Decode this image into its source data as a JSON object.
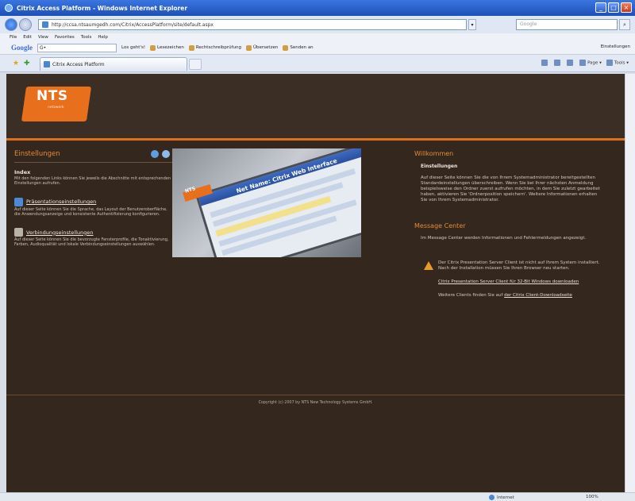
{
  "window": {
    "title": "Citrix Access Platform - Windows Internet Explorer",
    "buttons": [
      "_",
      "□",
      "×"
    ]
  },
  "address": {
    "url": "http://ccsa.ntsaumgedh.com/Citrix/AccessPlatform/site/default.aspx",
    "search_placeholder": "Google"
  },
  "menu": [
    "File",
    "Edit",
    "View",
    "Favorites",
    "Tools",
    "Help"
  ],
  "google_toolbar": {
    "logo": "Google",
    "input_value": "G•",
    "items": [
      "Los geht's!",
      "Lesezeichen",
      "Rechtschreibprüfung",
      "Übersetzen",
      "Senden an"
    ],
    "settings": "Einstellungen"
  },
  "tab": {
    "label": "Citrix Access Platform"
  },
  "command_bar": [
    "Page",
    "Tools"
  ],
  "logo": {
    "text": "NTS",
    "sub": "netzwerk"
  },
  "left": {
    "title": "Einstellungen",
    "index_title": "Index",
    "index_text": "Mit den folgenden Links können Sie jeweils die Abschnitte mit entsprechenden Einstellungen aufrufen.",
    "pres_link": "Präsentationseinstellungen",
    "pres_text": "Auf dieser Seite können Sie die Sprache, das Layout der Benutzeroberfläche, die Anwendungsanzeige und konsistente Authentifizierung konfigurieren.",
    "conn_link": "Verbindungseinstellungen",
    "conn_text": "Auf dieser Seite können Sie die bevorzugte Fensterprofile, die Tonaktivierung, Farben, Audioqualität und lokale Verbindungseinstellungen auswählen."
  },
  "hero": {
    "tag": "NTS",
    "header": "Net Name: Citrix Web Interface"
  },
  "right": {
    "welcome_title": "Willkommen",
    "welcome_sub": "Einstellungen",
    "welcome_text": "Auf dieser Seite können Sie die von Ihrem Systemadministrator bereitgestellten Standardeinstellungen überschreiben. Wenn Sie bei Ihrer nächsten Anmeldung beispielsweise den Ordner zuerst aufrufen möchten, in dem Sie zuletzt gearbeitet haben, aktivieren Sie 'Ordnerposition speichern'. Weitere Informationen erhalten Sie von Ihrem Systemadministrator.",
    "mc_title": "Message Center",
    "mc_text": "Im Message Center werden Informationen und Fehlermeldungen angezeigt.",
    "warn_text": "Der Citrix Presentation Server Client ist nicht auf Ihrem System installiert. Nach der Installation müssen Sie Ihren Browser neu starten.",
    "dl_link": "Citrix Presentation Server Client für 32-Bit Windows downloaden",
    "more_prefix": "Weitere Clients finden Sie auf ",
    "more_link": "der Citrix Client-Downloadseite"
  },
  "footer": {
    "copyright": "Copyright (c) 2007 by NTS New Technology Systems GmbH."
  },
  "status": {
    "zone": "Internet",
    "zoom": "100%"
  }
}
